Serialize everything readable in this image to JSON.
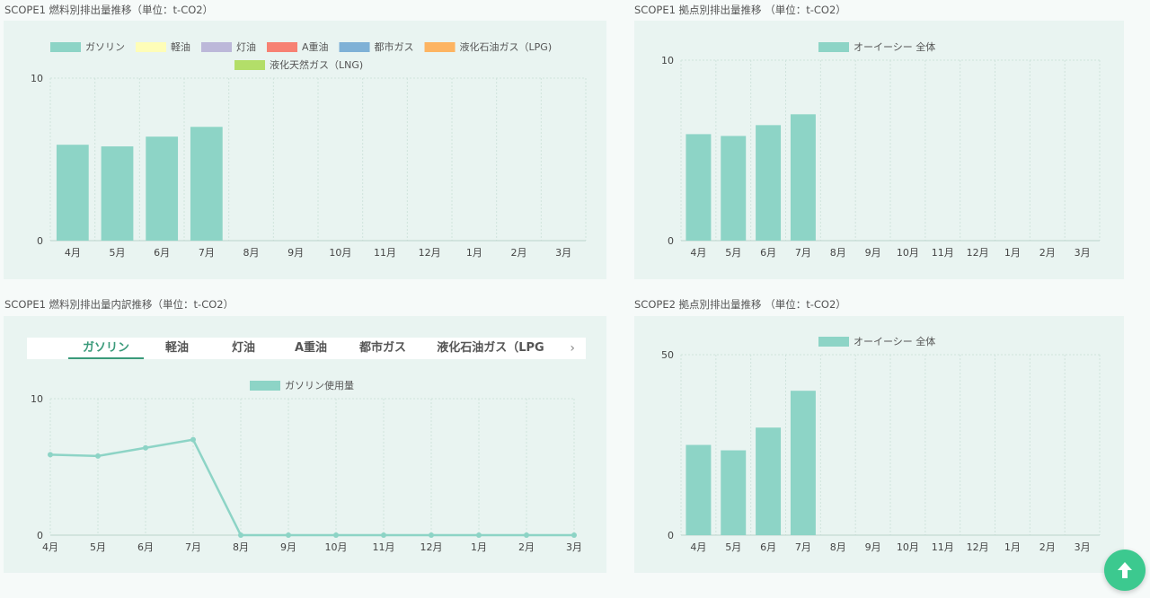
{
  "panels": {
    "p1": {
      "title": "SCOPE1 燃料別排出量推移（単位：t-CO2）"
    },
    "p2": {
      "title": "SCOPE1 拠点別排出量推移 （単位：t-CO2）"
    },
    "p3": {
      "title": "SCOPE1 燃料別排出量内訳推移（単位：t-CO2）"
    },
    "p4": {
      "title": "SCOPE2 拠点別排出量推移 （単位：t-CO2）"
    }
  },
  "tabs": {
    "items": [
      "ガソリン",
      "軽油",
      "灯油",
      "A重油",
      "都市ガス",
      "液化石油ガス（LPG"
    ],
    "active_index": 0,
    "next_glyph": "›"
  },
  "fab": {
    "icon": "arrow-up-icon",
    "color": "#3cc98f"
  },
  "chart_data": [
    {
      "type": "bar",
      "categories": [
        "4月",
        "5月",
        "6月",
        "7月",
        "8月",
        "9月",
        "10月",
        "11月",
        "12月",
        "1月",
        "2月",
        "3月"
      ],
      "legend": [
        {
          "name": "ガソリン",
          "color": "#8dd4c6"
        },
        {
          "name": "軽油",
          "color": "#fefdb8"
        },
        {
          "name": "灯油",
          "color": "#bcb8d9"
        },
        {
          "name": "A重油",
          "color": "#f78173"
        },
        {
          "name": "都市ガス",
          "color": "#7fb1d6"
        },
        {
          "name": "液化石油ガス（LPG)",
          "color": "#fdb462"
        },
        {
          "name": "液化天然ガス（LNG)",
          "color": "#b3de69"
        }
      ],
      "series": [
        {
          "name": "ガソリン",
          "values": [
            5.9,
            5.8,
            6.4,
            7.0,
            0,
            0,
            0,
            0,
            0,
            0,
            0,
            0
          ]
        }
      ],
      "yticks": [
        "0",
        "10"
      ],
      "ylim": [
        0,
        10
      ],
      "grid": true
    },
    {
      "type": "bar",
      "categories": [
        "4月",
        "5月",
        "6月",
        "7月",
        "8月",
        "9月",
        "10月",
        "11月",
        "12月",
        "1月",
        "2月",
        "3月"
      ],
      "legend": [
        {
          "name": "オーイーシー 全体",
          "color": "#8dd4c6"
        }
      ],
      "series": [
        {
          "name": "オーイーシー 全体",
          "values": [
            5.9,
            5.8,
            6.4,
            7.0,
            0,
            0,
            0,
            0,
            0,
            0,
            0,
            0
          ]
        }
      ],
      "yticks": [
        "0",
        "10"
      ],
      "ylim": [
        0,
        10
      ],
      "grid": true
    },
    {
      "type": "line",
      "categories": [
        "4月",
        "5月",
        "6月",
        "7月",
        "8月",
        "9月",
        "10月",
        "11月",
        "12月",
        "1月",
        "2月",
        "3月"
      ],
      "legend": [
        {
          "name": "ガソリン使用量",
          "color": "#8dd4c6"
        }
      ],
      "series": [
        {
          "name": "ガソリン使用量",
          "values": [
            5.9,
            5.8,
            6.4,
            7.0,
            0,
            0,
            0,
            0,
            0,
            0,
            0,
            0
          ]
        }
      ],
      "yticks": [
        "0",
        "10"
      ],
      "ylim": [
        0,
        10
      ],
      "grid": true
    },
    {
      "type": "bar",
      "categories": [
        "4月",
        "5月",
        "6月",
        "7月",
        "8月",
        "9月",
        "10月",
        "11月",
        "12月",
        "1月",
        "2月",
        "3月"
      ],
      "legend": [
        {
          "name": "オーイーシー 全体",
          "color": "#8dd4c6"
        }
      ],
      "series": [
        {
          "name": "オーイーシー 全体",
          "values": [
            25,
            23.5,
            29.8,
            40,
            0,
            0,
            0,
            0,
            0,
            0,
            0,
            0
          ]
        }
      ],
      "yticks": [
        "0",
        "50"
      ],
      "ylim": [
        0,
        50
      ],
      "grid": true
    }
  ]
}
